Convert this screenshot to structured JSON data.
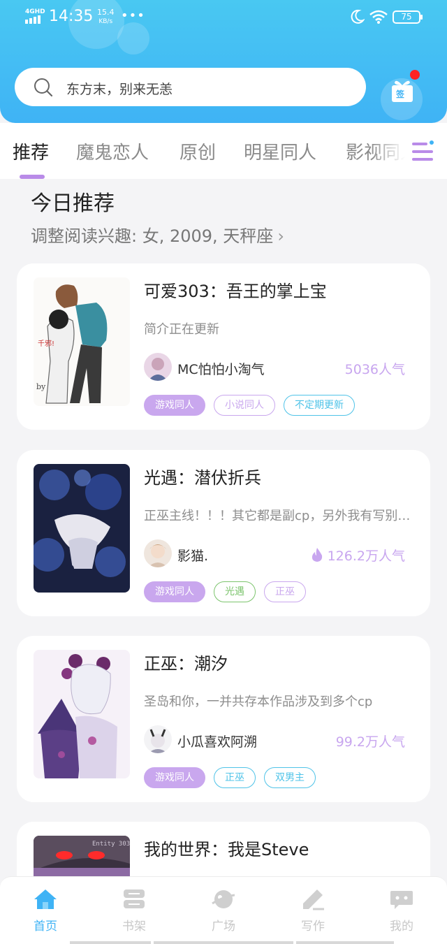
{
  "status_bar": {
    "network": "4GHD",
    "time": "14:35",
    "speed_value": "15.4",
    "speed_unit": "KB/s",
    "more": "•••",
    "battery": "75"
  },
  "search": {
    "placeholder": "东方末，别来无恙"
  },
  "checkin": {
    "label": "签"
  },
  "tabs": [
    {
      "label": "推荐"
    },
    {
      "label": "魔鬼恋人"
    },
    {
      "label": "原创"
    },
    {
      "label": "明星同人"
    },
    {
      "label": "影视同人"
    }
  ],
  "section": {
    "title": "今日推荐",
    "subtitle": "调整阅读兴趣: 女, 2009, 天秤座"
  },
  "colors": {
    "accent": "#3fb3f5",
    "purple": "#c8a6ef",
    "tag_fill": "#c9a7ee",
    "tag_purple": "#c9a7ee",
    "tag_blue": "#4fc3e8",
    "tag_green": "#7cc46d"
  },
  "books": [
    {
      "title": "可爱303：吾王的掌上宝",
      "desc": "简介正在更新",
      "author": "MC怕怕小淘气",
      "popularity": "5036人气",
      "hot": false,
      "tags": [
        {
          "label": "游戏同人",
          "style": "fill"
        },
        {
          "label": "小说同人",
          "style": "purple"
        },
        {
          "label": "不定期更新",
          "style": "blue"
        }
      ]
    },
    {
      "title": "光遇：潜伏折兵",
      "desc": "正巫主线！！！其它都是副cp，另外我有写别的作品",
      "author": "影猫.",
      "popularity": "126.2万人气",
      "hot": true,
      "tags": [
        {
          "label": "游戏同人",
          "style": "fill"
        },
        {
          "label": "光遇",
          "style": "green"
        },
        {
          "label": "正巫",
          "style": "purple"
        }
      ]
    },
    {
      "title": "正巫：潮汐",
      "desc": "圣岛和你，一并共存本作品涉及到多个cp",
      "author": "小瓜喜欢阿溯",
      "popularity": "99.2万人气",
      "hot": false,
      "tags": [
        {
          "label": "游戏同人",
          "style": "fill"
        },
        {
          "label": "正巫",
          "style": "blue"
        },
        {
          "label": "双男主",
          "style": "blue"
        }
      ]
    },
    {
      "title": "我的世界：我是Steve",
      "cover_text": "Entity 303"
    }
  ],
  "bottom_nav": [
    {
      "label": "首页",
      "icon": "home-icon"
    },
    {
      "label": "书架",
      "icon": "bookshelf-icon"
    },
    {
      "label": "广场",
      "icon": "planet-icon"
    },
    {
      "label": "写作",
      "icon": "pen-icon"
    },
    {
      "label": "我的",
      "icon": "chat-bubble-icon"
    }
  ]
}
